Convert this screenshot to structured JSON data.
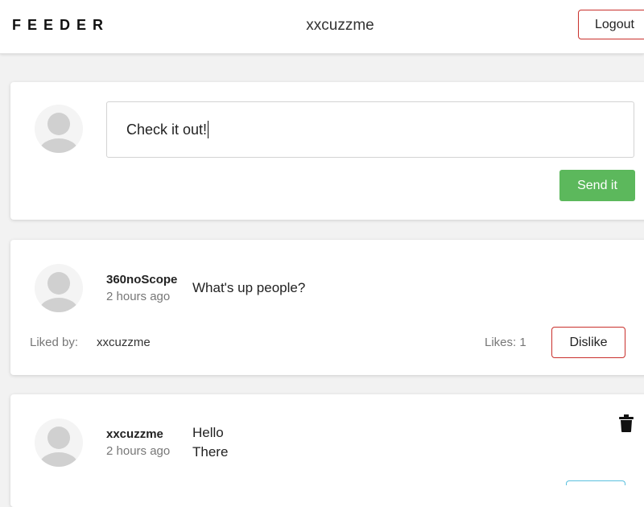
{
  "header": {
    "brand": "FEEDER",
    "username": "xxcuzzme",
    "logout_label": "Logout"
  },
  "compose": {
    "avatar_icon": "user-avatar-icon",
    "input_value": "Check it out!",
    "send_label": "Send it"
  },
  "posts": [
    {
      "author": "360noScope",
      "time": "2 hours ago",
      "lines": [
        "What's up people?"
      ],
      "liked_by_label": "Liked by:",
      "liked_by": "xxcuzzme",
      "likes_label": "Likes: 1",
      "action_label": "Dislike"
    },
    {
      "author": "xxcuzzme",
      "time": "2 hours ago",
      "lines": [
        "Hello",
        "There"
      ],
      "delete_icon": "trash-icon"
    }
  ],
  "colors": {
    "danger": "#c9302c",
    "success": "#5cb85c",
    "info": "#5bc0de"
  }
}
